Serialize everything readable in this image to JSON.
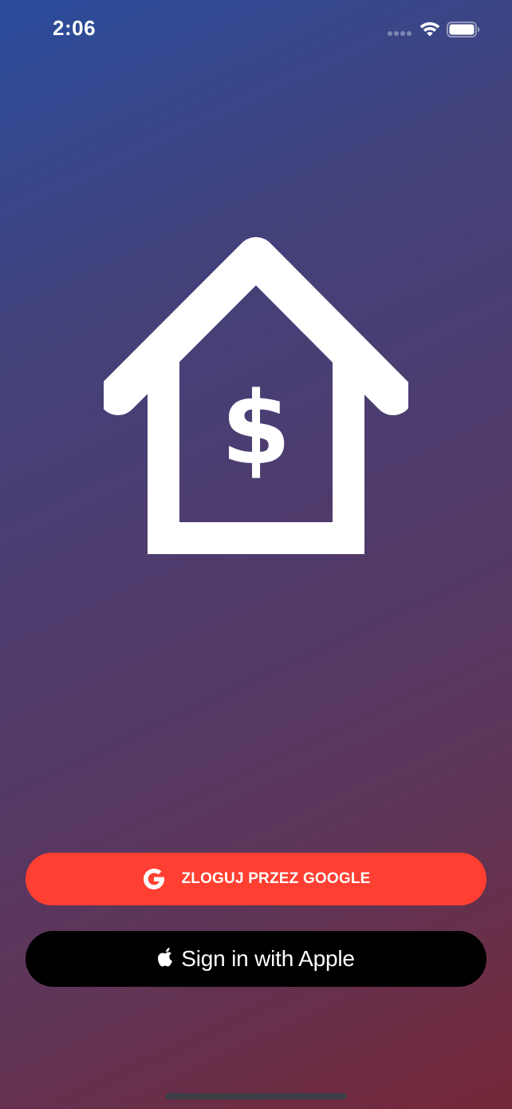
{
  "status_bar": {
    "time": "2:06",
    "icons": [
      "signal-icon",
      "wifi-icon",
      "battery-icon"
    ]
  },
  "logo": {
    "icon": "house-dollar-icon",
    "symbol": "$"
  },
  "buttons": {
    "google": {
      "label": "ZLOGUJ PRZEZ GOOGLE",
      "icon": "google-g-icon",
      "color": "#ff3f31"
    },
    "apple": {
      "label": "Sign in with Apple",
      "icon": "apple-icon",
      "color": "#000000"
    }
  },
  "theme": {
    "gradient_top": "#2a4c9c",
    "gradient_bottom": "#752838",
    "foreground": "#ffffff"
  }
}
